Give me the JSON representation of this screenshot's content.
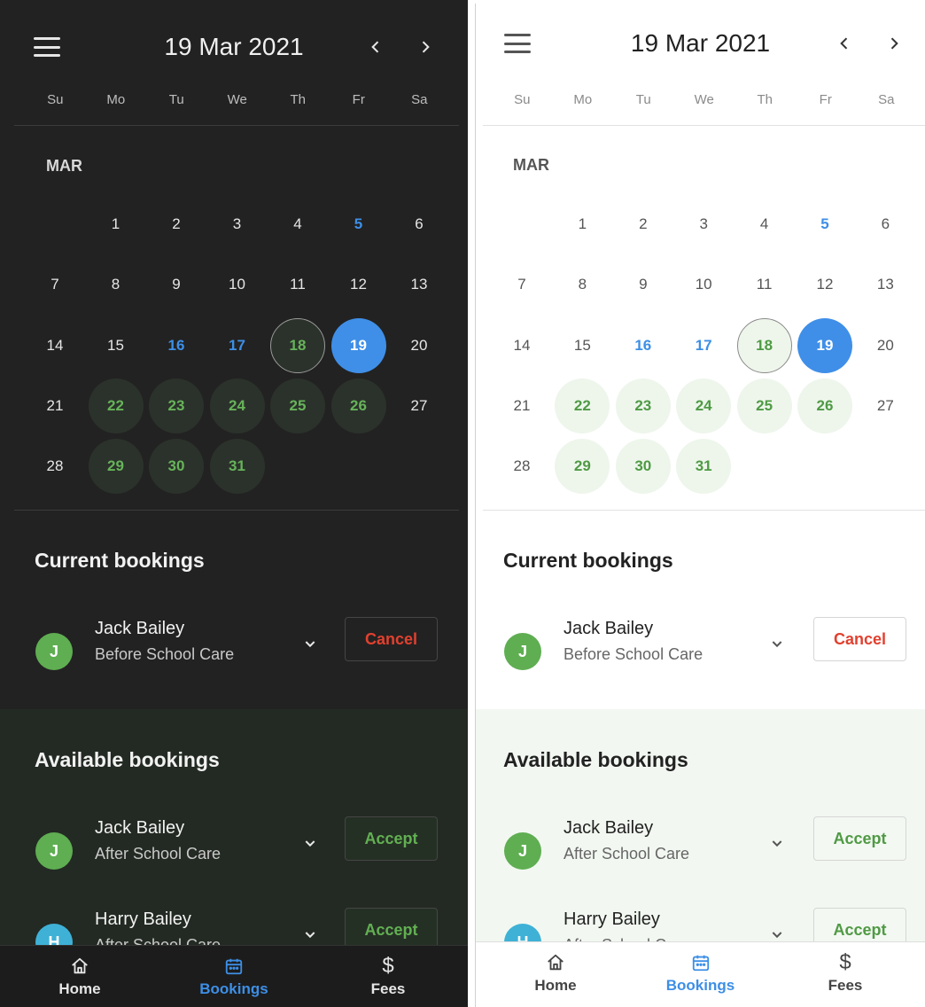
{
  "header": {
    "title": "19 Mar 2021",
    "prev": "‹",
    "next": "›"
  },
  "weekdays": [
    "Su",
    "Mo",
    "Tu",
    "We",
    "Th",
    "Fr",
    "Sa"
  ],
  "month_label": "MAR",
  "calendar": {
    "rows": [
      [
        null,
        "1",
        "2",
        "3",
        "4",
        "5",
        "6"
      ],
      [
        "7",
        "8",
        "9",
        "10",
        "11",
        "12",
        "13"
      ],
      [
        "14",
        "15",
        "16",
        "17",
        "18",
        "19",
        "20"
      ],
      [
        "21",
        "22",
        "23",
        "24",
        "25",
        "26",
        "27"
      ],
      [
        "28",
        "29",
        "30",
        "31",
        null,
        null,
        null
      ]
    ],
    "blue_days": [
      "5",
      "16",
      "17"
    ],
    "booked_days": [
      "22",
      "23",
      "24",
      "25",
      "26",
      "29",
      "30",
      "31"
    ],
    "outlined_day": "18",
    "selected_day": "19"
  },
  "current": {
    "title": "Current bookings",
    "items": [
      {
        "initial": "J",
        "name": "Jack Bailey",
        "sub": "Before School Care",
        "action": "Cancel",
        "avatar_color": "#5fae52"
      }
    ]
  },
  "available": {
    "title": "Available bookings",
    "items": [
      {
        "initial": "J",
        "name": "Jack Bailey",
        "sub": "After School Care",
        "action": "Accept",
        "avatar_color": "#5fae52"
      },
      {
        "initial": "H",
        "name": "Harry Bailey",
        "sub": "After School Care",
        "action": "Accept",
        "avatar_color": "#3fb1d6"
      }
    ]
  },
  "bottom_nav": [
    {
      "key": "home",
      "label": "Home",
      "icon": "home-icon"
    },
    {
      "key": "bookings",
      "label": "Bookings",
      "icon": "calendar-icon",
      "active": true
    },
    {
      "key": "fees",
      "label": "Fees",
      "icon": "dollar-icon"
    }
  ],
  "colors": {
    "accent_blue": "#3f8fe8",
    "green": "#5fae52",
    "red": "#e2402f",
    "cyan": "#3fb1d6"
  }
}
